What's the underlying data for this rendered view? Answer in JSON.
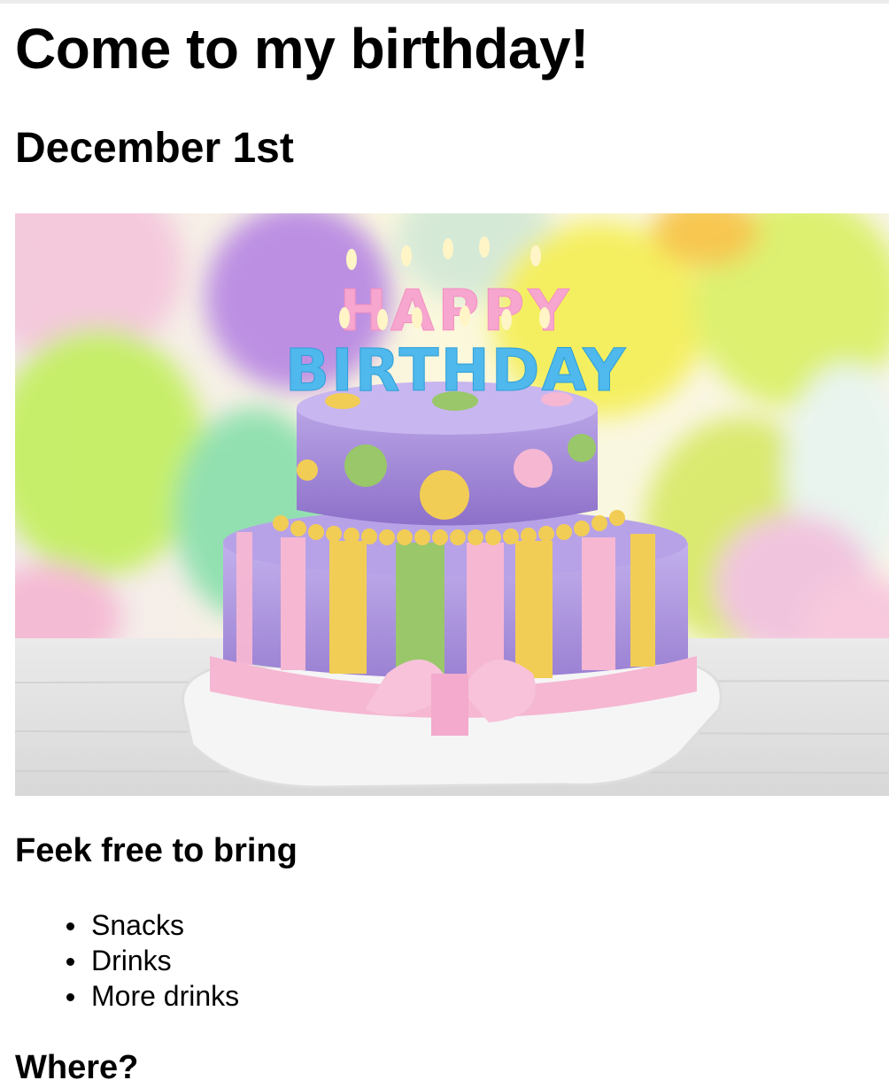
{
  "page": {
    "title": "Come to my birthday!",
    "date": "December 1st",
    "image": {
      "description_icon": "birthday-cake-image",
      "candle_text_line1": "HAPPY",
      "candle_text_line2": "BIRTHDAY"
    },
    "bring_heading": "Feek free to bring",
    "bring_items": [
      "Snacks",
      "Drinks",
      "More drinks"
    ],
    "where_heading": "Where?"
  },
  "colors": {
    "text": "#000000",
    "background": "#ffffff",
    "cake_top": "#a489d6",
    "cake_pink": "#f6b7d3",
    "cake_yellow": "#f2cd55",
    "cake_green": "#99c76a"
  }
}
